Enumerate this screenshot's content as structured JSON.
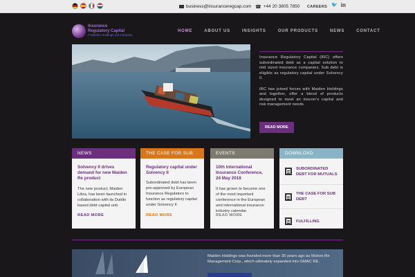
{
  "topbar": {
    "email": "business@insuranceregcap.com",
    "phone": "+44 20 3805 7850",
    "careers": "CAREERS",
    "social": {
      "twitter": "twitter-icon",
      "linkedin": "linkedin-icon"
    },
    "twitter_glyph": "🐦",
    "linkedin_glyph": "in"
  },
  "logo": {
    "line1": "Insurance",
    "line2": "Regulatory Capital",
    "line3": "A Maiden Holdings Ltd company"
  },
  "nav": [
    "HOME",
    "ABOUT US",
    "INSIGHTS",
    "OUR PRODUCTS",
    "NEWS",
    "CONTACT"
  ],
  "hero": {
    "p1": "Insurance Regulatory Capital (IRC) offers subordinated debt as a capital solution to mid sized insurance companies. Sub debt is eligible as regulatory capital under Solvency II.",
    "p2": "IRC has joined forces with Maiden Holdings and together, offer a blend of products designed to meet an insurer's capital and risk management needs.",
    "button": "READ MORE"
  },
  "cards": [
    {
      "header": "NEWS",
      "color": "#6b2f7e",
      "title": "Solvency II drives demand for new Maiden Re product",
      "body": "The new product, Maiden Libra, has been launched in collaboration with its Dublin based debt capital unit.",
      "more": "READ MORE"
    },
    {
      "header": "THE CASE FOR SUB DEBT",
      "color": "#d8761c",
      "title": "Regulatory capital under Solvency II",
      "body": "Subordinated debt has been pre-approved by European Insurance Regulators to function as regulatory capital under Solvency II",
      "more": "READ MORE"
    },
    {
      "header": "EVENTS",
      "color": "#7d7a70",
      "title": "10th International Insurance Conference, 24 May 2018",
      "body": "It has grown to become one of the most important conference in the European and international insurance industry calendar.",
      "more": "READ MORE"
    }
  ],
  "download": {
    "header": "DOWNLOAD",
    "color": "#8bb3c6",
    "items": [
      "SUBORDINATED DEBT FOR MUTUALS",
      "THE CASE FOR SUB DEBT",
      "FULFILLING"
    ]
  },
  "banner": {
    "text": "Maiden Holdings was founded more than 30 years ago as Motors Re Management Corp., which ultimately expanded into GMAC RE."
  }
}
